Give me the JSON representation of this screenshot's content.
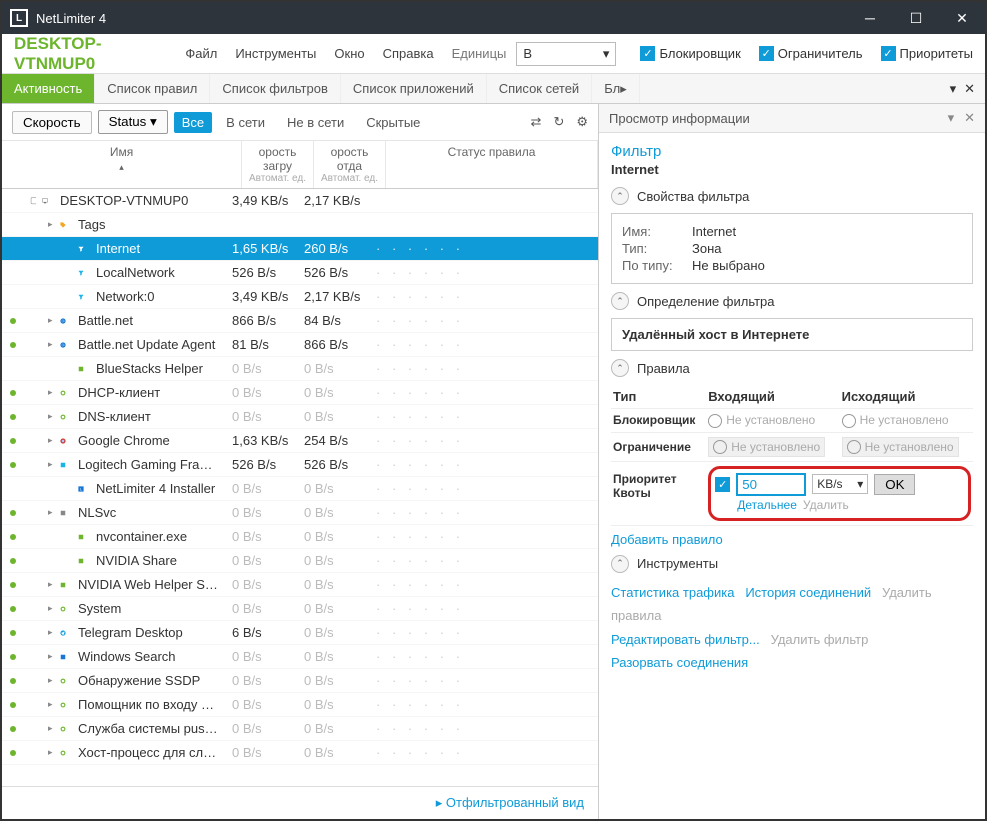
{
  "window": {
    "title": "NetLimiter 4"
  },
  "hostname": "DESKTOP-VTNMUP0",
  "menu": {
    "file": "Файл",
    "tools": "Инструменты",
    "window": "Окно",
    "help": "Справка",
    "units_label": "Единицы",
    "units_value": "B"
  },
  "top_checks": {
    "blocker": "Блокировщик",
    "limiter": "Ограничитель",
    "priority": "Приоритеты"
  },
  "tabs": {
    "activity": "Активность",
    "rules": "Список правил",
    "filters": "Список фильтров",
    "apps": "Список приложений",
    "nets": "Список сетей",
    "more": "Бл"
  },
  "toolbar": {
    "speed": "Скорость",
    "status": "Status",
    "all": "Все",
    "online": "В сети",
    "offline": "Не в сети",
    "hidden": "Скрытые"
  },
  "grid_head": {
    "name": "Имя",
    "dl": "орость загру",
    "ul": "орость отда",
    "unit": "Автомат. ед.",
    "status": "Статус правила"
  },
  "rows": [
    {
      "dot": false,
      "tg": "▢",
      "depth": 0,
      "ico": "pc",
      "name": "DESKTOP-VTNMUP0",
      "dl": "3,49 KB/s",
      "ul": "2,17 KB/s",
      "st": "",
      "sel": false
    },
    {
      "dot": false,
      "tg": "▸",
      "depth": 1,
      "ico": "tag",
      "name": "Tags",
      "dl": "",
      "ul": "",
      "st": "",
      "sel": false
    },
    {
      "dot": false,
      "tg": "",
      "depth": 2,
      "ico": "funnel",
      "name": "Internet",
      "dl": "1,65 KB/s",
      "ul": "260 B/s",
      "st": "· · · · · ·",
      "sel": true
    },
    {
      "dot": false,
      "tg": "",
      "depth": 2,
      "ico": "funnel",
      "name": "LocalNetwork",
      "dl": "526 B/s",
      "ul": "526 B/s",
      "st": "· · · · · ·",
      "sel": false
    },
    {
      "dot": false,
      "tg": "",
      "depth": 2,
      "ico": "funnel",
      "name": "Network:0",
      "dl": "3,49 KB/s",
      "ul": "2,17 KB/s",
      "st": "· · · · · ·",
      "sel": false
    },
    {
      "dot": true,
      "tg": "▸",
      "depth": 1,
      "ico": "bnet",
      "name": "Battle.net",
      "dl": "866 B/s",
      "ul": "84 B/s",
      "st": "· · · · · ·",
      "sel": false
    },
    {
      "dot": true,
      "tg": "▸",
      "depth": 1,
      "ico": "bnet",
      "name": "Battle.net Update Agent",
      "dl": "81 B/s",
      "ul": "866 B/s",
      "st": "· · · · · ·",
      "sel": false
    },
    {
      "dot": false,
      "tg": "",
      "depth": 2,
      "ico": "bs",
      "name": "BlueStacks Helper",
      "dl": "0 B/s",
      "ul": "0 B/s",
      "st": "· · · · · ·",
      "sel": false
    },
    {
      "dot": true,
      "tg": "▸",
      "depth": 1,
      "ico": "gear",
      "name": "DHCP-клиент",
      "dl": "0 B/s",
      "ul": "0 B/s",
      "st": "· · · · · ·",
      "sel": false
    },
    {
      "dot": true,
      "tg": "▸",
      "depth": 1,
      "ico": "gear",
      "name": "DNS-клиент",
      "dl": "0 B/s",
      "ul": "0 B/s",
      "st": "· · · · · ·",
      "sel": false
    },
    {
      "dot": true,
      "tg": "▸",
      "depth": 1,
      "ico": "chrome",
      "name": "Google Chrome",
      "dl": "1,63 KB/s",
      "ul": "254 B/s",
      "st": "· · · · · ·",
      "sel": false
    },
    {
      "dot": true,
      "tg": "▸",
      "depth": 1,
      "ico": "logi",
      "name": "Logitech Gaming Framewor",
      "dl": "526 B/s",
      "ul": "526 B/s",
      "st": "· · · · · ·",
      "sel": false
    },
    {
      "dot": false,
      "tg": "",
      "depth": 2,
      "ico": "nl",
      "name": "NetLimiter 4 Installer",
      "dl": "0 B/s",
      "ul": "0 B/s",
      "st": "· · · · · ·",
      "sel": false
    },
    {
      "dot": true,
      "tg": "▸",
      "depth": 1,
      "ico": "nls",
      "name": "NLSvc",
      "dl": "0 B/s",
      "ul": "0 B/s",
      "st": "· · · · · ·",
      "sel": false
    },
    {
      "dot": true,
      "tg": "",
      "depth": 2,
      "ico": "nv",
      "name": "nvcontainer.exe",
      "dl": "0 B/s",
      "ul": "0 B/s",
      "st": "· · · · · ·",
      "sel": false
    },
    {
      "dot": true,
      "tg": "",
      "depth": 2,
      "ico": "nv",
      "name": "NVIDIA Share",
      "dl": "0 B/s",
      "ul": "0 B/s",
      "st": "· · · · · ·",
      "sel": false
    },
    {
      "dot": true,
      "tg": "▸",
      "depth": 1,
      "ico": "nv",
      "name": "NVIDIA Web Helper Service",
      "dl": "0 B/s",
      "ul": "0 B/s",
      "st": "· · · · · ·",
      "sel": false
    },
    {
      "dot": true,
      "tg": "▸",
      "depth": 1,
      "ico": "gear",
      "name": "System",
      "dl": "0 B/s",
      "ul": "0 B/s",
      "st": "· · · · · ·",
      "sel": false
    },
    {
      "dot": true,
      "tg": "▸",
      "depth": 1,
      "ico": "tg",
      "name": "Telegram Desktop",
      "dl": "6 B/s",
      "ul": "0 B/s",
      "st": "· · · · · ·",
      "sel": false
    },
    {
      "dot": true,
      "tg": "▸",
      "depth": 1,
      "ico": "win",
      "name": "Windows Search",
      "dl": "0 B/s",
      "ul": "0 B/s",
      "st": "· · · · · ·",
      "sel": false
    },
    {
      "dot": true,
      "tg": "▸",
      "depth": 1,
      "ico": "gear",
      "name": "Обнаружение SSDP",
      "dl": "0 B/s",
      "ul": "0 B/s",
      "st": "· · · · · ·",
      "sel": false
    },
    {
      "dot": true,
      "tg": "▸",
      "depth": 1,
      "ico": "gear",
      "name": "Помощник по входу в уче",
      "dl": "0 B/s",
      "ul": "0 B/s",
      "st": "· · · · · ·",
      "sel": false
    },
    {
      "dot": true,
      "tg": "▸",
      "depth": 1,
      "ico": "gear",
      "name": "Служба системы push-уве,",
      "dl": "0 B/s",
      "ul": "0 B/s",
      "st": "· · · · · ·",
      "sel": false
    },
    {
      "dot": true,
      "tg": "▸",
      "depth": 1,
      "ico": "gear",
      "name": "Хост-процесс для служб W",
      "dl": "0 B/s",
      "ul": "0 B/s",
      "st": "· · · · · ·",
      "sel": false
    }
  ],
  "filtered_view": "Отфильтрованный вид",
  "info": {
    "header": "Просмотр информации",
    "filter_title": "Фильтр",
    "filter_name": "Internet",
    "props_header": "Свойства фильтра",
    "props": {
      "name_k": "Имя:",
      "name_v": "Internet",
      "type_k": "Тип:",
      "type_v": "Зона",
      "bytype_k": "По типу:",
      "bytype_v": "Не выбрано"
    },
    "def_header": "Определение фильтра",
    "def_value": "Удалённый хост в Интернете",
    "rules_header": "Правила",
    "rt": {
      "type": "Тип",
      "in": "Входящий",
      "out": "Исходящий",
      "blocker": "Блокировщик",
      "limit": "Ограничение",
      "priority": "Приоритет",
      "quotas": "Квоты",
      "notset": "Не установлено",
      "value": "50",
      "unit": "KB/s",
      "ok": "OK",
      "details": "Детальнее",
      "delete": "Удалить"
    },
    "add_rule": "Добавить правило",
    "tools_header": "Инструменты",
    "tool_links": {
      "stats": "Статистика трафика",
      "hist": "История соединений",
      "delrules": "Удалить правила",
      "editf": "Редактировать фильтр...",
      "delf": "Удалить фильтр",
      "term": "Разорвать соединения"
    }
  }
}
